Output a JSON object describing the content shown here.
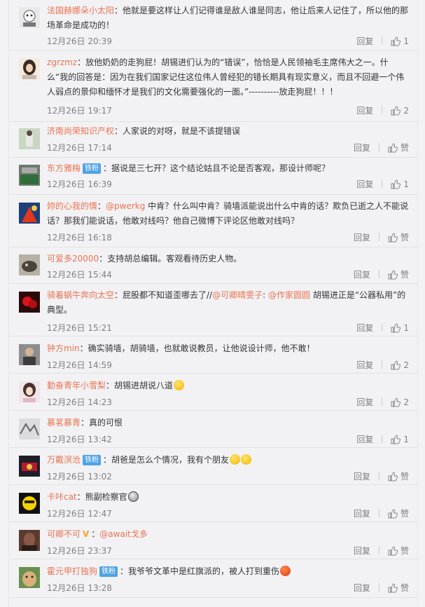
{
  "reply_label": "回复",
  "comments": [
    {
      "user": "法国赫娜朵小太阳",
      "text": "：他就是要这样让人们记得谁是敌人谁是同志，他让后来人记住了，所以他的那场革命是成功的！",
      "time": "12月26日 20:39",
      "likes": "1"
    },
    {
      "user": "zgrzmz",
      "text": "：放他奶奶的走狗屁！胡锡进们认为的“错误”，恰恰是人民领袖毛主席伟大之一。什么“我的回答是：因为在我们国家记住这位伟人曾经犯的错长期具有现实意义，而且不回避一个伟人弱点的景仰和缅怀才是我们的文化需要强化的一面。”----------放走狗屁！！！",
      "time": "12月26日 19:17",
      "likes": "2"
    },
    {
      "user": "济南尚荣知识产权",
      "text": "：人家说的对呀，就是不该提错误",
      "time": "12月26日 17:14",
      "likes": "赞"
    },
    {
      "user": "东方雅梅",
      "badge": "铁粉",
      "text": "：据说是三七开？这个结论姑且不论是否客观，那设计师呢？",
      "time": "12月26日 16:39",
      "likes": "1"
    },
    {
      "user": "妳的心我的情",
      "mention": "@pwerkg",
      "text": " 中肯？什么叫中肯？骑墙派能说出什么中肯的话？欺负已逝之人不能说话？那我们能说话，他敢对线吗？他自己微博下评论区他敢对线吗？",
      "time": "12月26日 16:18",
      "likes": "赞"
    },
    {
      "user": "可爱多20000",
      "text": "：支持胡总编辑。客观看待历史人物。",
      "time": "12月26日 15:44",
      "likes": "赞"
    },
    {
      "user": "骑着蜗牛奔向太空",
      "text": "：屁股都不知道歪哪去了//",
      "mention": "@可卿晴雯子",
      "text_mid": ": ",
      "mention2": "@作家圆圆",
      "text2": " 胡锡进正是“公器私用”的典型。",
      "time": "12月26日 15:21",
      "likes": "1"
    },
    {
      "user": "钟方min",
      "text": "：确实骑墙，胡骑墙，也就敢说教员，让他说设计师，他不敢！",
      "time": "12月26日 14:59",
      "likes": "2"
    },
    {
      "user": "勤奋青年小雪梨",
      "text": "：胡锡进胡说八道",
      "emoji": "yellow",
      "time": "12月26日 14:23",
      "likes": "2"
    },
    {
      "user": "慕茗慕青",
      "text": "：真的可恨",
      "time": "12月26日 13:42",
      "likes": "1"
    },
    {
      "user": "万戴溟沧",
      "badge": "铁粉",
      "text": "：胡爸是怎么个情况，我有个朋友",
      "emoji": "yellow",
      "emoji2": "yellow",
      "time": "12月26日 13:02",
      "likes": "赞"
    },
    {
      "user": "卡咔cat",
      "text": "：熊副检察官",
      "emoji": "gray",
      "time": "12月26日 12:47",
      "likes": "赞"
    },
    {
      "user": "可卿不可",
      "vip": "V",
      "text": "：",
      "mention": "@await戈多",
      "time": "12月26日 23:37",
      "likes": "赞"
    },
    {
      "user": "霍元甲打独狗",
      "badge": "铁粉",
      "text": "：我爷爷文革中是红旗派的，被人打到重伤",
      "emoji": "red",
      "time": "12月26日 13:28",
      "likes": "赞"
    }
  ],
  "colors": {
    "username": "#eb7350",
    "badge": "#4fa3e4",
    "meta": "#808080"
  }
}
